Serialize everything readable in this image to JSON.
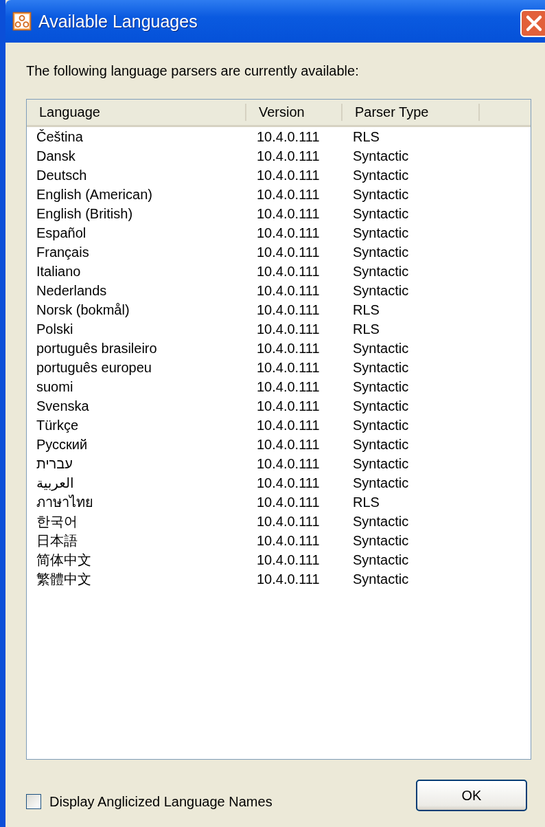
{
  "window": {
    "title": "Available Languages"
  },
  "intro": "The following language parsers are currently available:",
  "table": {
    "columns": [
      "Language",
      "Version",
      "Parser Type"
    ],
    "rows": [
      [
        "Čeština",
        "10.4.0.111",
        "RLS"
      ],
      [
        "Dansk",
        "10.4.0.111",
        "Syntactic"
      ],
      [
        "Deutsch",
        "10.4.0.111",
        "Syntactic"
      ],
      [
        "English (American)",
        "10.4.0.111",
        "Syntactic"
      ],
      [
        "English (British)",
        "10.4.0.111",
        "Syntactic"
      ],
      [
        "Español",
        "10.4.0.111",
        "Syntactic"
      ],
      [
        "Français",
        "10.4.0.111",
        "Syntactic"
      ],
      [
        "Italiano",
        "10.4.0.111",
        "Syntactic"
      ],
      [
        "Nederlands",
        "10.4.0.111",
        "Syntactic"
      ],
      [
        "Norsk (bokmål)",
        "10.4.0.111",
        "RLS"
      ],
      [
        "Polski",
        "10.4.0.111",
        "RLS"
      ],
      [
        "português brasileiro",
        "10.4.0.111",
        "Syntactic"
      ],
      [
        "português europeu",
        "10.4.0.111",
        "Syntactic"
      ],
      [
        "suomi",
        "10.4.0.111",
        "Syntactic"
      ],
      [
        "Svenska",
        "10.4.0.111",
        "Syntactic"
      ],
      [
        "Türkçe",
        "10.4.0.111",
        "Syntactic"
      ],
      [
        "Русский",
        "10.4.0.111",
        "Syntactic"
      ],
      [
        "עברית",
        "10.4.0.111",
        "Syntactic"
      ],
      [
        "العربية",
        "10.4.0.111",
        "Syntactic"
      ],
      [
        "ภาษาไทย",
        "10.4.0.111",
        "RLS"
      ],
      [
        "한국어",
        "10.4.0.111",
        "Syntactic"
      ],
      [
        "日本語",
        "10.4.0.111",
        "Syntactic"
      ],
      [
        "简体中文",
        "10.4.0.111",
        "Syntactic"
      ],
      [
        "繁體中文",
        "10.4.0.111",
        "Syntactic"
      ]
    ]
  },
  "anglicized_checkbox": {
    "label": "Display Anglicized Language Names",
    "checked": false
  },
  "buttons": [
    "OK"
  ]
}
